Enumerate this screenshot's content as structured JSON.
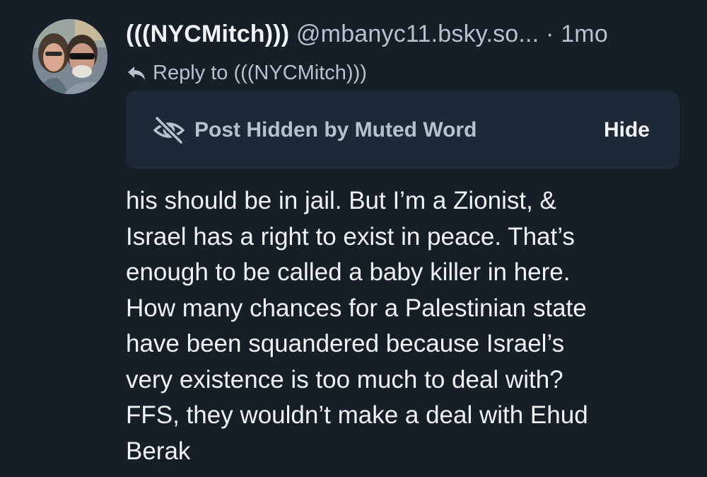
{
  "post": {
    "author": {
      "display_name": "(((NYCMitch)))",
      "handle": "@mbanyc11.bsky.so...",
      "avatar_icon": "avatar-photo"
    },
    "separator": "·",
    "timestamp": "1mo",
    "reply_to": {
      "icon": "reply-arrow-icon",
      "label": "Reply to (((NYCMitch)))"
    },
    "muted_notice": {
      "icon": "eye-slash-icon",
      "label": "Post Hidden by Muted Word",
      "hide_label": "Hide"
    },
    "text_lines": [
      "his should be in jail. But I’m a Zionist, &",
      "Israel has a right to exist in peace. That’s",
      "enough to be called a baby killer in here.",
      "How many chances for a Palestinian state",
      "have been squandered because Israel’s",
      "very existence is too much to deal with?",
      "FFS, they wouldn’t make a deal with Ehud",
      "Berak"
    ]
  },
  "colors": {
    "background": "#161e27",
    "card": "#1e2937",
    "text_primary": "#f1f3f5",
    "text_secondary": "#b8c2cc"
  }
}
